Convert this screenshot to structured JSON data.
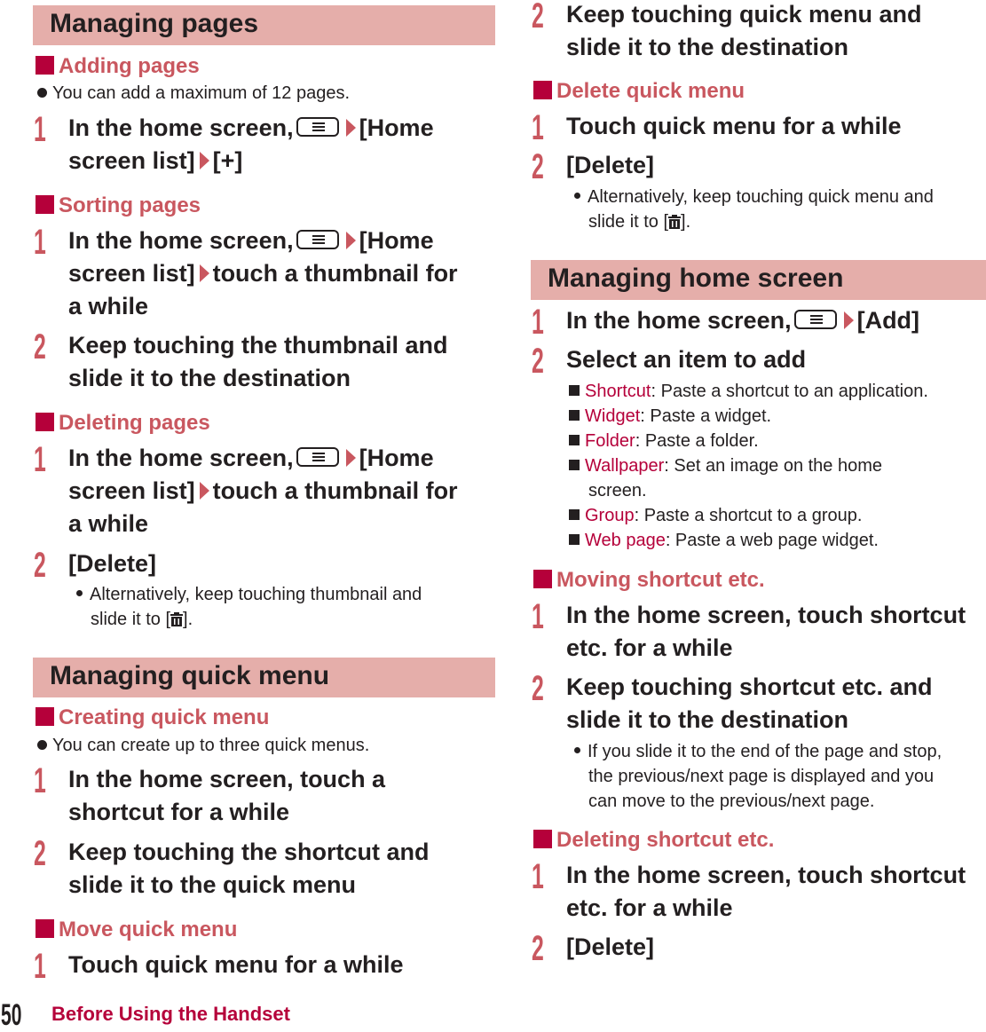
{
  "left": {
    "managing_pages": {
      "title": "Managing pages",
      "adding": {
        "heading": "Adding pages",
        "note": "You can add a maximum of 12 pages.",
        "step1": {
          "num": "1",
          "a": "In the home screen,",
          "b": "[Home",
          "line2a": "screen list]",
          "line2b": "[+]"
        }
      },
      "sorting": {
        "heading": "Sorting pages",
        "step1": {
          "num": "1",
          "a": "In the home screen,",
          "b": "[Home",
          "line2a": "screen list]",
          "line2b": "touch a thumbnail for",
          "line3": "a while"
        },
        "step2": {
          "num": "2",
          "line1": "Keep touching the thumbnail and",
          "line2": "slide it to the destination"
        }
      },
      "deleting": {
        "heading": "Deleting pages",
        "step1": {
          "num": "1",
          "a": "In the home screen,",
          "b": "[Home",
          "line2a": "screen list]",
          "line2b": "touch a thumbnail for",
          "line3": "a while"
        },
        "step2": {
          "num": "2",
          "line1": "[Delete]"
        },
        "sub_line1": "Alternatively, keep touching thumbnail and",
        "sub_line2a": "slide it to [",
        "sub_line2b": "]."
      }
    },
    "managing_quick_menu": {
      "title": "Managing quick menu",
      "creating": {
        "heading": "Creating quick menu",
        "note": "You can create up to three quick menus.",
        "step1": {
          "num": "1",
          "line1": "In the home screen, touch a",
          "line2": "shortcut for a while"
        },
        "step2": {
          "num": "2",
          "line1": "Keep touching the shortcut and",
          "line2": "slide it to the quick menu"
        }
      },
      "move": {
        "heading": "Move quick menu",
        "step1": {
          "num": "1",
          "line1": "Touch quick menu for a while"
        }
      }
    }
  },
  "right": {
    "move_cont": {
      "step2": {
        "num": "2",
        "line1": "Keep touching quick menu and",
        "line2": "slide it to the destination"
      }
    },
    "delete_quick": {
      "heading": "Delete quick menu",
      "step1": {
        "num": "1",
        "line1": "Touch quick menu for a while"
      },
      "step2": {
        "num": "2",
        "line1": "[Delete]"
      },
      "sub_line1": "Alternatively, keep touching quick menu and",
      "sub_line2a": "slide it to [",
      "sub_line2b": "]."
    },
    "managing_home": {
      "title": "Managing home screen",
      "step1": {
        "num": "1",
        "a": "In the home screen,",
        "b": "[Add]"
      },
      "step2": {
        "num": "2",
        "line1": "Select an item to add"
      },
      "items": [
        {
          "kw": "Shortcut",
          "desc": ": Paste a shortcut to an application."
        },
        {
          "kw": "Widget",
          "desc": ": Paste a widget."
        },
        {
          "kw": "Folder",
          "desc": ": Paste a folder."
        },
        {
          "kw": "Wallpaper",
          "desc": ": Set an image on the home",
          "cont": "screen."
        },
        {
          "kw": "Group",
          "desc": ": Paste a shortcut to a group."
        },
        {
          "kw": "Web page",
          "desc": ": Paste a web page widget."
        }
      ]
    },
    "moving_shortcut": {
      "heading": "Moving shortcut etc.",
      "step1": {
        "num": "1",
        "line1": "In the home screen, touch shortcut",
        "line2": "etc. for a while"
      },
      "step2": {
        "num": "2",
        "line1": "Keep touching shortcut etc. and",
        "line2": "slide it to the destination"
      },
      "sub_lines": [
        "If you slide it to the end of the page and stop,",
        "the previous/next page is displayed and you",
        "can move to the previous/next page."
      ]
    },
    "deleting_shortcut": {
      "heading": "Deleting shortcut etc.",
      "step1": {
        "num": "1",
        "line1": "In the home screen, touch shortcut",
        "line2": "etc. for a while"
      },
      "step2": {
        "num": "2",
        "line1": "[Delete]"
      }
    }
  },
  "footer": {
    "page_number": "50",
    "section": "Before Using the Handset"
  },
  "colors": {
    "banner": "#e5aeaa",
    "heading_text": "#c9575f",
    "accent": "#b5003a",
    "body_text": "#231f20"
  }
}
